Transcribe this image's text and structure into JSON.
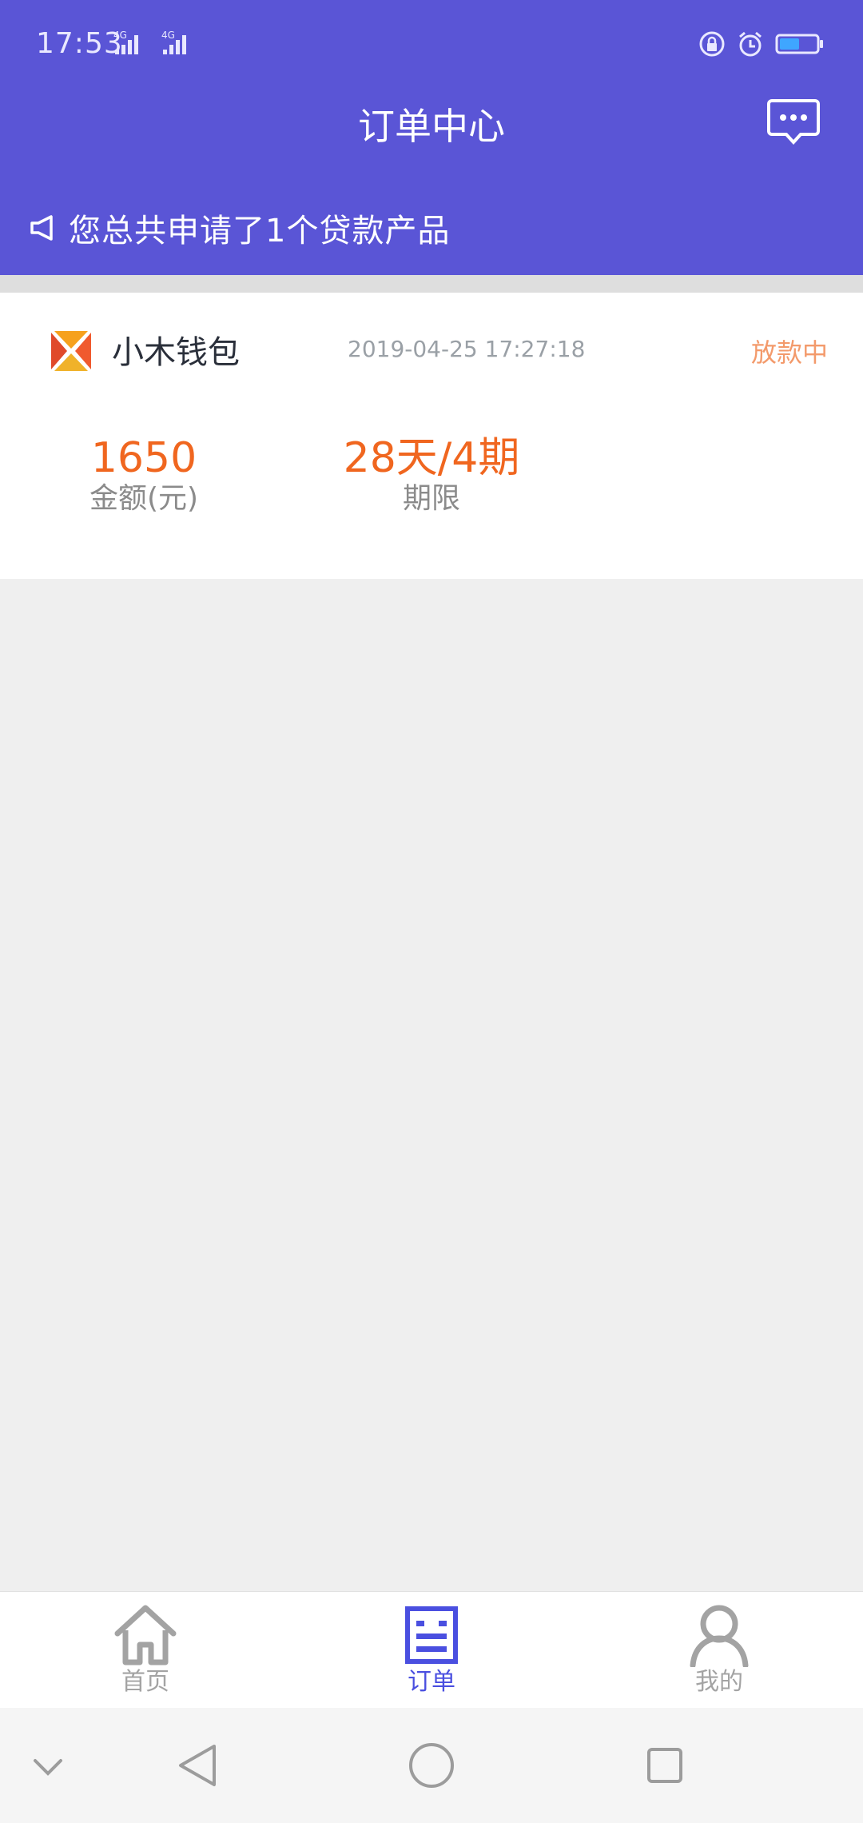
{
  "status_bar": {
    "time": "17:53",
    "network_1": "4G",
    "network_2": "4G"
  },
  "header": {
    "title": "订单中心",
    "message_icon": "chat-bubble-icon"
  },
  "notice": {
    "icon": "megaphone-icon",
    "text": "您总共申请了1个贷款产品"
  },
  "order": {
    "product_name": "小木钱包",
    "time": "2019-04-25 17:27:18",
    "status": "放款中",
    "amount": "1650",
    "amount_label": "金额(元)",
    "term": "28天/4期",
    "term_label": "期限"
  },
  "bottom_nav": {
    "items": [
      {
        "label": "首页",
        "icon": "home-icon",
        "active": false
      },
      {
        "label": "订单",
        "icon": "order-icon",
        "active": true
      },
      {
        "label": "我的",
        "icon": "user-icon",
        "active": false
      }
    ]
  },
  "colors": {
    "header_bg": "#5a55d6",
    "accent_orange": "#f0661f",
    "status_orange": "#f39a6b",
    "nav_active": "#4a4fe0",
    "nav_inactive": "#a3a3a3"
  }
}
